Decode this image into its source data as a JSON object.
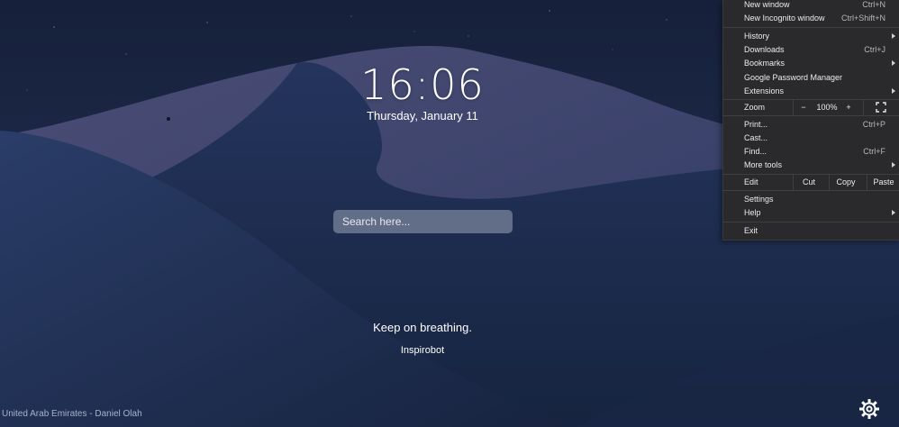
{
  "clock": {
    "time": "16:06",
    "date": "Thursday, January 11"
  },
  "search": {
    "placeholder": "Search here..."
  },
  "quote": {
    "text": "Keep on breathing.",
    "author": "Inspirobot"
  },
  "photo_credit": "United Arab Emirates - Daniel Olah",
  "settings": {
    "icon": "gear-icon"
  },
  "menu": {
    "new_window": {
      "label": "New window",
      "shortcut": "Ctrl+N"
    },
    "new_incognito": {
      "label": "New Incognito window",
      "shortcut": "Ctrl+Shift+N"
    },
    "history": {
      "label": "History"
    },
    "downloads": {
      "label": "Downloads",
      "shortcut": "Ctrl+J"
    },
    "bookmarks": {
      "label": "Bookmarks"
    },
    "password_manager": {
      "label": "Google Password Manager"
    },
    "extensions": {
      "label": "Extensions"
    },
    "zoom": {
      "label": "Zoom",
      "minus": "−",
      "value": "100%",
      "plus": "+"
    },
    "print": {
      "label": "Print...",
      "shortcut": "Ctrl+P"
    },
    "cast": {
      "label": "Cast..."
    },
    "find": {
      "label": "Find...",
      "shortcut": "Ctrl+F"
    },
    "more_tools": {
      "label": "More tools"
    },
    "edit": {
      "label": "Edit",
      "cut": "Cut",
      "copy": "Copy",
      "paste": "Paste"
    },
    "settings": {
      "label": "Settings"
    },
    "help": {
      "label": "Help"
    },
    "exit": {
      "label": "Exit"
    }
  },
  "colors": {
    "sky": "#1c2a49",
    "menu_bg": "#2a2a2c",
    "text": "#ffffff"
  }
}
